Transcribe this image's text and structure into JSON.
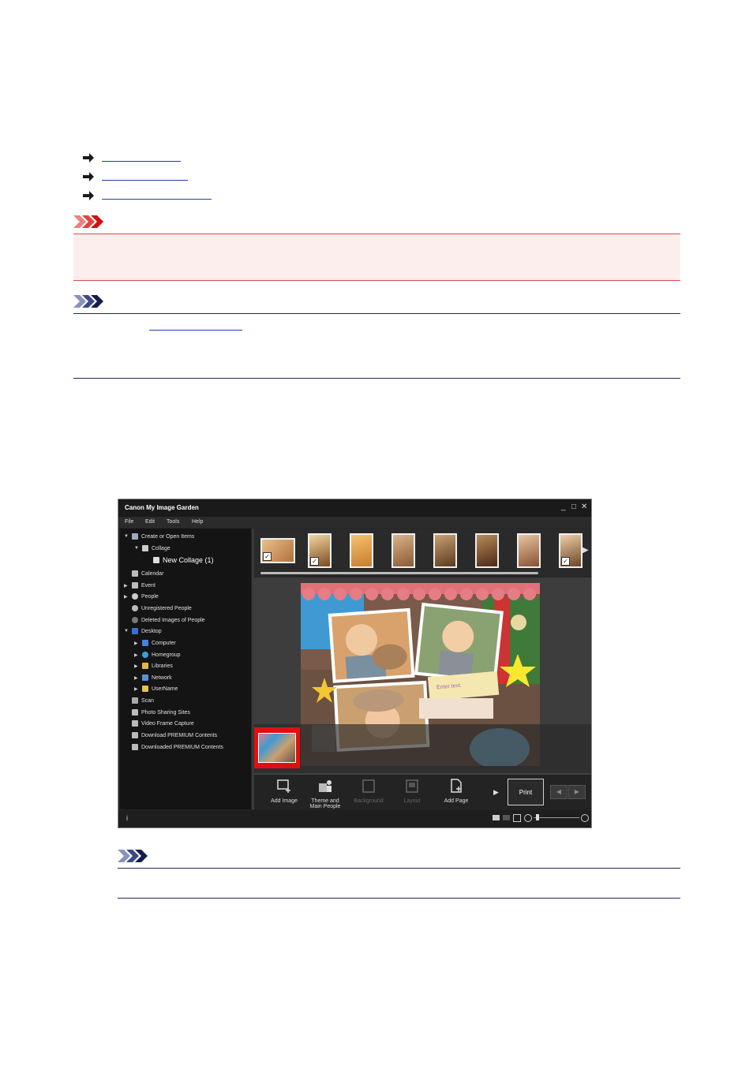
{
  "app": {
    "title": "Canon My Image Garden",
    "window_controls": [
      "_",
      "□",
      "✕"
    ],
    "menu": [
      "File",
      "Edit",
      "Tools",
      "Help"
    ],
    "sidebar": [
      {
        "label": "Create or Open Items",
        "icon": "create-items-icon",
        "level": 0,
        "expanded": true
      },
      {
        "label": "Collage",
        "icon": "collage-icon",
        "level": 1,
        "expanded": true
      },
      {
        "label": "New Collage (1)",
        "icon": "collage-doc-icon",
        "level": 2,
        "selected": true
      },
      {
        "label": "Calendar",
        "icon": "calendar-icon",
        "level": 0
      },
      {
        "label": "Event",
        "icon": "event-icon",
        "level": 0,
        "collapsed": true
      },
      {
        "label": "People",
        "icon": "people-icon",
        "level": 0,
        "collapsed": true
      },
      {
        "label": "Unregistered People",
        "icon": "unregistered-people-icon",
        "level": 0
      },
      {
        "label": "Deleted Images of People",
        "icon": "deleted-people-icon",
        "level": 0
      },
      {
        "label": "Desktop",
        "icon": "desktop-icon",
        "level": 0,
        "expanded": true
      },
      {
        "label": "Computer",
        "icon": "computer-icon",
        "level": 1,
        "collapsed": true
      },
      {
        "label": "Homegroup",
        "icon": "homegroup-icon",
        "level": 1,
        "collapsed": true
      },
      {
        "label": "Libraries",
        "icon": "libraries-icon",
        "level": 1,
        "collapsed": true
      },
      {
        "label": "Network",
        "icon": "network-icon",
        "level": 1,
        "collapsed": true
      },
      {
        "label": "UserName",
        "icon": "user-folder-icon",
        "level": 1,
        "collapsed": true
      },
      {
        "label": "Scan",
        "icon": "scan-icon",
        "level": 0
      },
      {
        "label": "Photo Sharing Sites",
        "icon": "photo-sharing-icon",
        "level": 0
      },
      {
        "label": "Video Frame Capture",
        "icon": "video-frame-icon",
        "level": 0
      },
      {
        "label": "Download PREMIUM Contents",
        "icon": "download-premium-icon",
        "level": 0
      },
      {
        "label": "Downloaded PREMIUM Contents",
        "icon": "downloaded-premium-icon",
        "level": 0
      }
    ],
    "collage_text": {
      "enter_text": "Enter text."
    },
    "toolbar": {
      "add_image": "Add Image",
      "theme_line1": "Theme and",
      "theme_line2": "Main People",
      "background": "Background",
      "layout": "Layout",
      "add_page": "Add Page",
      "print": "Print"
    },
    "status": {
      "info": "i"
    }
  },
  "colors": {
    "important_border": "#d94a4a",
    "important_bg": "#fdeeee",
    "note_border": "#1e2a5a",
    "selection_red": "#e01010"
  }
}
